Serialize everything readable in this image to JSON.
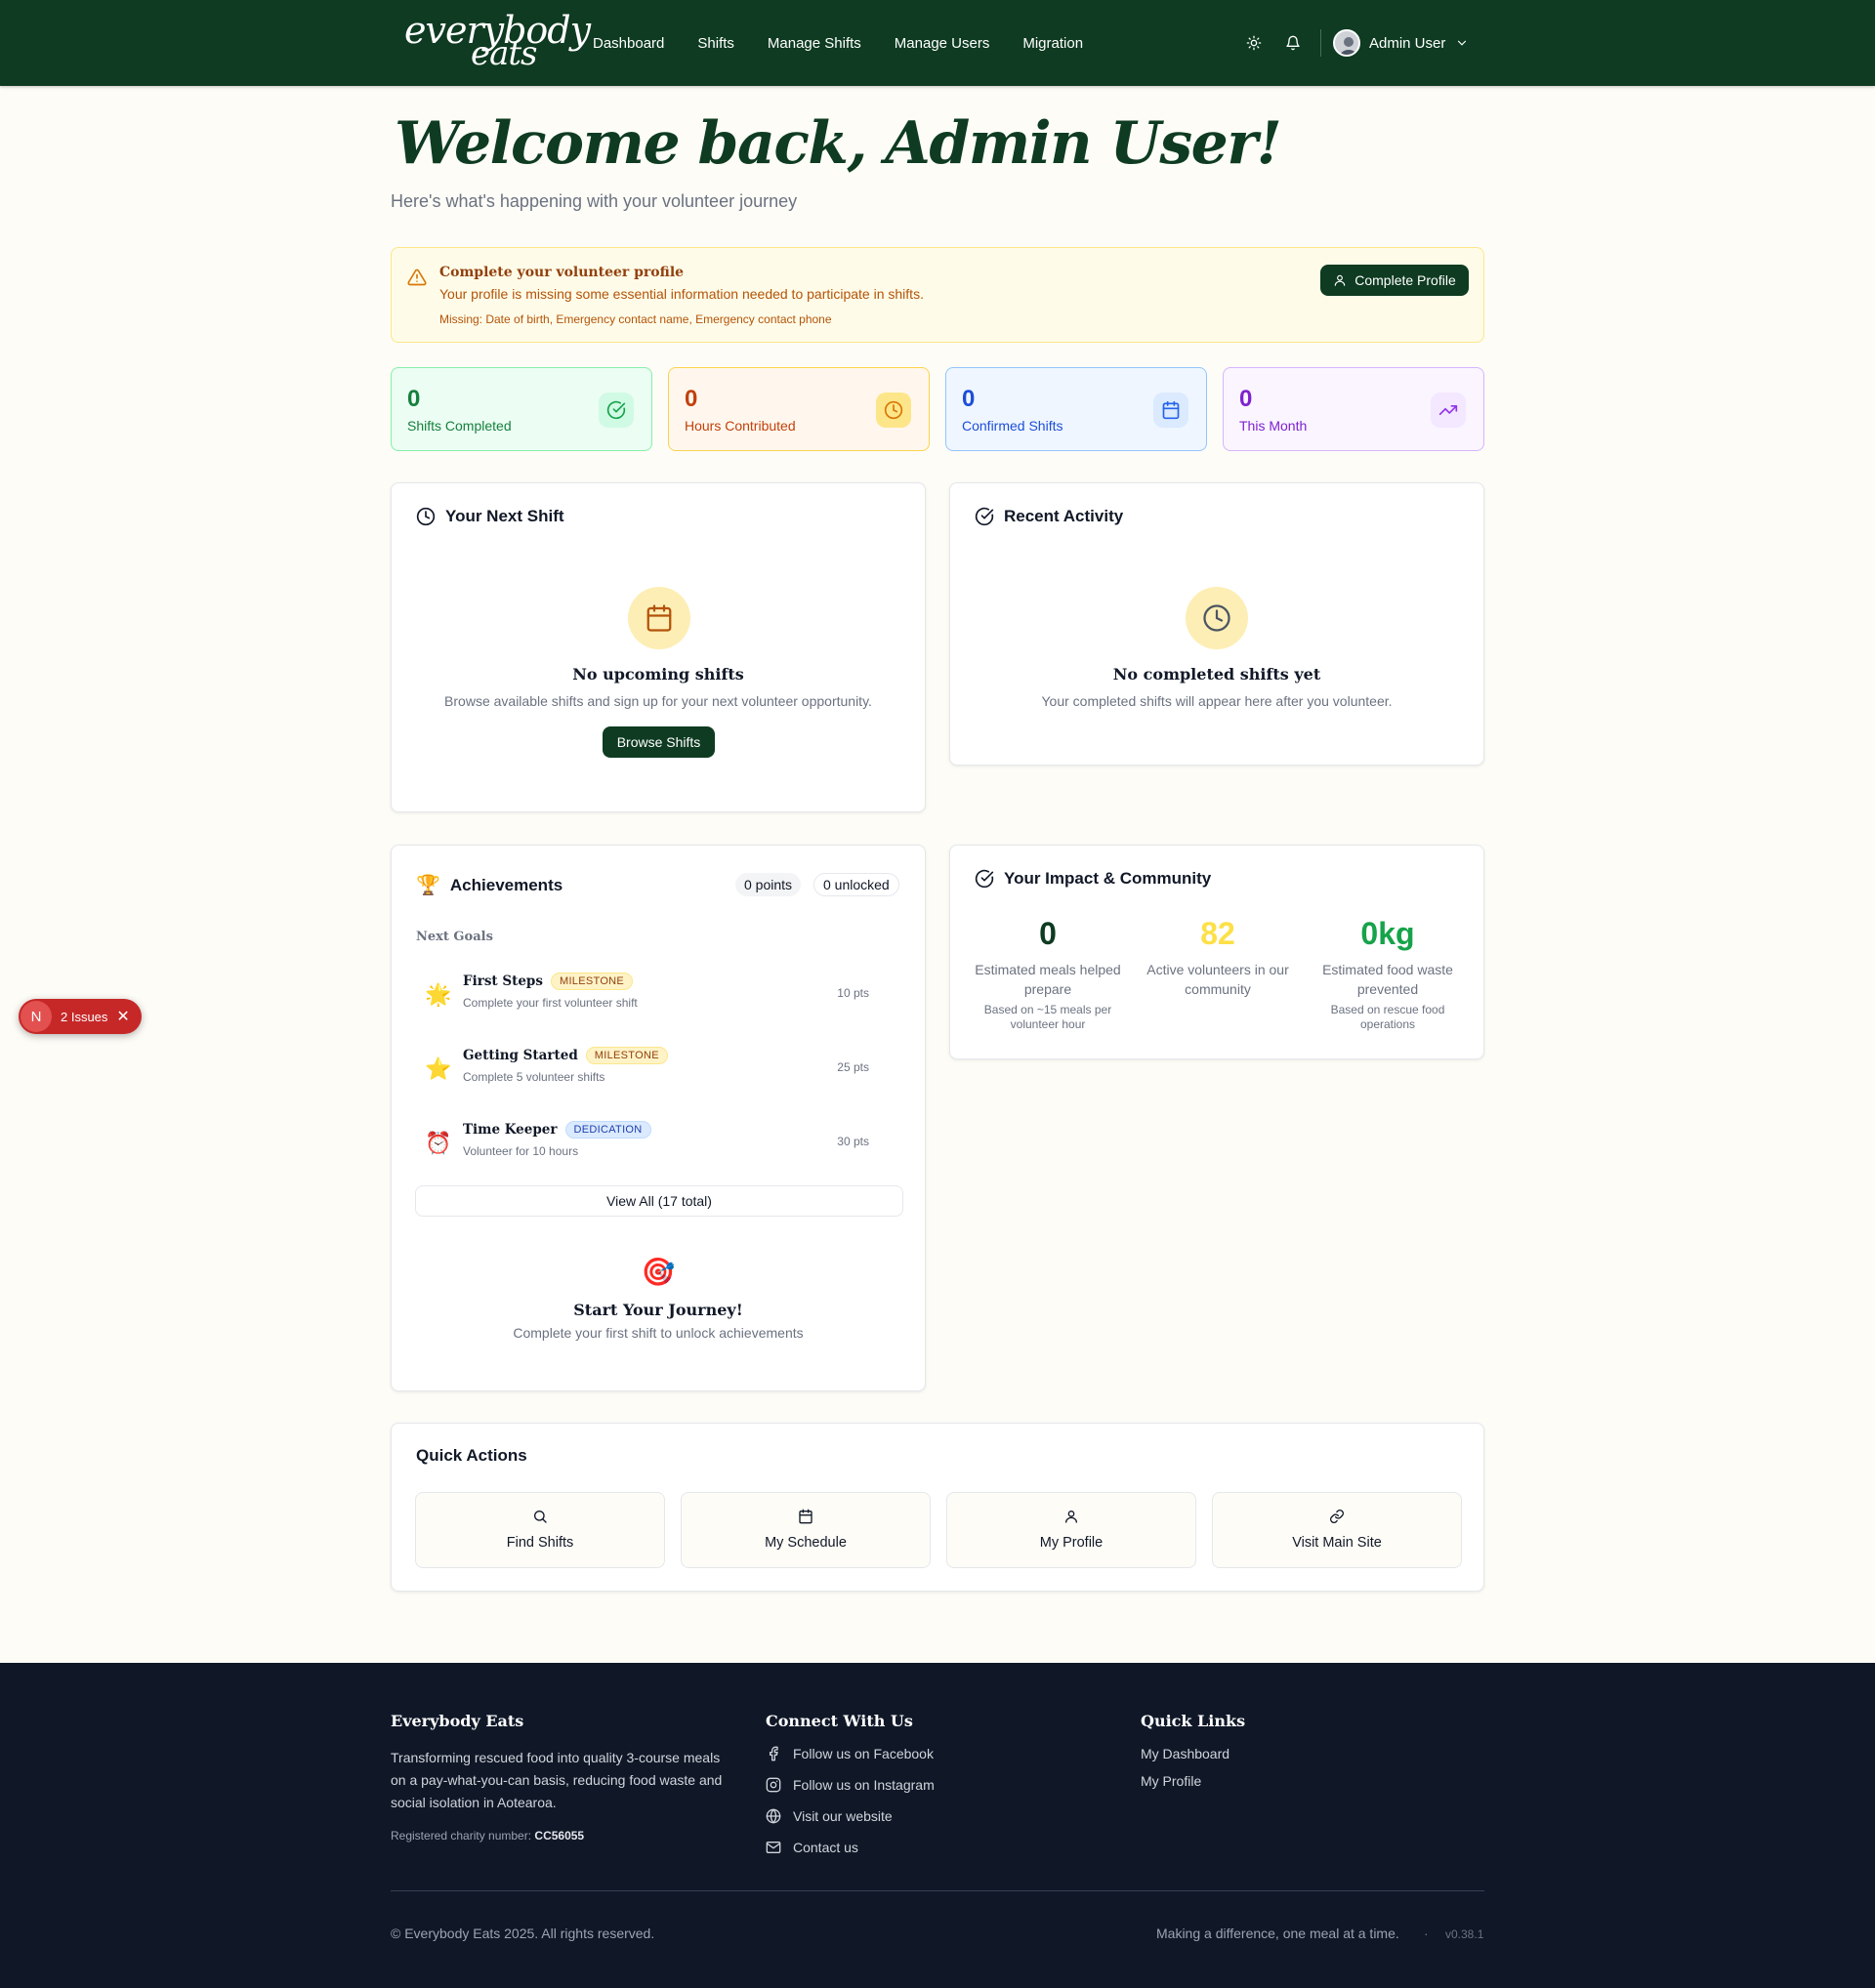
{
  "header": {
    "logo_line1": "everybody",
    "logo_line2": "eats",
    "nav": [
      "Dashboard",
      "Shifts",
      "Manage Shifts",
      "Manage Users",
      "Migration"
    ],
    "user_name": "Admin User"
  },
  "welcome": {
    "title": "Welcome back, Admin User!",
    "subtitle": "Here's what's happening with your volunteer journey"
  },
  "alert": {
    "title": "Complete your volunteer profile",
    "description": "Your profile is missing some essential information needed to participate in shifts.",
    "missing": "Missing: Date of birth, Emergency contact name, Emergency contact phone",
    "button": "Complete Profile"
  },
  "stats": [
    {
      "value": "0",
      "label": "Shifts Completed",
      "icon": "check-circle-icon"
    },
    {
      "value": "0",
      "label": "Hours Contributed",
      "icon": "clock-icon"
    },
    {
      "value": "0",
      "label": "Confirmed Shifts",
      "icon": "calendar-icon"
    },
    {
      "value": "0",
      "label": "This Month",
      "icon": "trending-up-icon"
    }
  ],
  "next_shift": {
    "title": "Your Next Shift",
    "empty_title": "No upcoming shifts",
    "empty_desc": "Browse available shifts and sign up for your next volunteer opportunity.",
    "button": "Browse Shifts"
  },
  "recent_activity": {
    "title": "Recent Activity",
    "empty_title": "No completed shifts yet",
    "empty_desc": "Your completed shifts will appear here after you volunteer."
  },
  "achievements": {
    "title": "Achievements",
    "points": "0 points",
    "unlocked": "0 unlocked",
    "next_goals_label": "Next Goals",
    "goals": [
      {
        "icon": "🌟",
        "name": "First Steps",
        "badge": "MILESTONE",
        "desc": "Complete your first volunteer shift",
        "pts": "10 pts"
      },
      {
        "icon": "⭐",
        "name": "Getting Started",
        "badge": "MILESTONE",
        "desc": "Complete 5 volunteer shifts",
        "pts": "25 pts"
      },
      {
        "icon": "⏰",
        "name": "Time Keeper",
        "badge": "DEDICATION",
        "desc": "Volunteer for 10 hours",
        "pts": "30 pts"
      }
    ],
    "view_all": "View All (17 total)",
    "journey_icon": "🎯",
    "journey_title": "Start Your Journey!",
    "journey_desc": "Complete your first shift to unlock achievements"
  },
  "impact": {
    "title": "Your Impact & Community",
    "items": [
      {
        "value": "0",
        "label": "Estimated meals helped prepare",
        "note": "Based on ~15 meals per volunteer hour",
        "color": "#0e3b21"
      },
      {
        "value": "82",
        "label": "Active volunteers in our community",
        "note": "",
        "color": "#fde047"
      },
      {
        "value": "0kg",
        "label": "Estimated food waste prevented",
        "note": "Based on rescue food operations",
        "color": "#16a34a"
      }
    ]
  },
  "quick_actions": {
    "title": "Quick Actions",
    "items": [
      {
        "label": "Find Shifts",
        "icon": "search-icon"
      },
      {
        "label": "My Schedule",
        "icon": "calendar-icon"
      },
      {
        "label": "My Profile",
        "icon": "user-icon"
      },
      {
        "label": "Visit Main Site",
        "icon": "link-icon"
      }
    ]
  },
  "issues_badge": {
    "letter": "N",
    "text": "2 Issues"
  },
  "footer": {
    "about_title": "Everybody Eats",
    "about_text": "Transforming rescued food into quality 3-course meals on a pay-what-you-can basis, reducing food waste and social isolation in Aotearoa.",
    "charity_label": "Registered charity number: ",
    "charity_number": "CC56055",
    "connect_title": "Connect With Us",
    "connect_links": [
      "Follow us on Facebook",
      "Follow us on Instagram",
      "Visit our website",
      "Contact us"
    ],
    "quick_title": "Quick Links",
    "quick_links": [
      "My Dashboard",
      "My Profile"
    ],
    "copyright": "© Everybody Eats 2025. All rights reserved.",
    "tagline": "Making a difference, one meal at a time.",
    "separator": "·",
    "version": "v0.38.1"
  }
}
